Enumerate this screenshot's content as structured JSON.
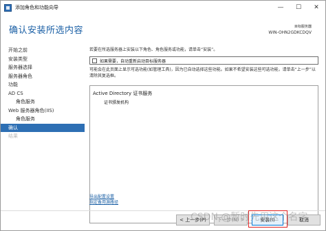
{
  "window": {
    "title": "添加角色和功能向导",
    "controls": {
      "minimize": "—",
      "maximize": "☐",
      "close": "✕"
    }
  },
  "header": {
    "title": "确认安装所选内容",
    "server_caption": "目标服务器",
    "server_name": "WIN-OHN2GDKCDQV"
  },
  "nav": {
    "items": [
      {
        "label": "开始之前",
        "state": "normal"
      },
      {
        "label": "安装类型",
        "state": "normal"
      },
      {
        "label": "服务器选择",
        "state": "normal"
      },
      {
        "label": "服务器角色",
        "state": "normal"
      },
      {
        "label": "功能",
        "state": "normal"
      },
      {
        "label": "AD CS",
        "state": "normal"
      },
      {
        "label": "角色服务",
        "state": "sub"
      },
      {
        "label": "Web 服务器角色(IIS)",
        "state": "normal"
      },
      {
        "label": "角色服务",
        "state": "sub"
      },
      {
        "label": "确认",
        "state": "active"
      },
      {
        "label": "结果",
        "state": "disabled"
      }
    ]
  },
  "content": {
    "intro": "若要在所选服务器上安装以下角色、角色服务或功能，请单击“安装”。",
    "restart_checkbox_label": "如果需要，自动重新启动目标服务器",
    "restart_checked": false,
    "note": "可能会在此页面上显示可选功能(如管理工具)，因为已自动选择这些功能。如果不希望安装这些可选功能，请单击“上一步”以清除其复选框。",
    "features": [
      {
        "name": "Active Directory 证书服务",
        "children": [
          "证书颁发机构"
        ]
      }
    ],
    "links": {
      "export": "导出配置设置",
      "alternate_source": "指定备用源路径"
    }
  },
  "footer": {
    "prev": "< 上一步(P)",
    "next": "下一步(N) >",
    "install": "安装(I)",
    "cancel": "取消"
  },
  "watermark": "CSDN @暂时先用这个名字",
  "colors": {
    "accent": "#1a5fa5",
    "nav_active": "#2d6fb4",
    "highlight": "#e02020"
  }
}
